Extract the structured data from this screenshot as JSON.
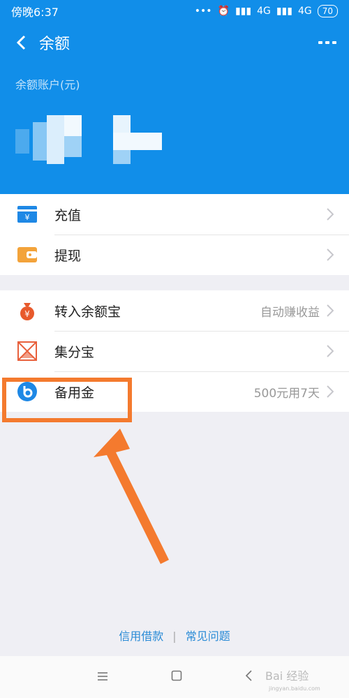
{
  "status_bar": {
    "time": "傍晚6:37",
    "network_1": "4G",
    "network_2": "4G",
    "battery": "70"
  },
  "nav": {
    "title": "余额"
  },
  "header": {
    "account_label": "余额账户(元)"
  },
  "section1": [
    {
      "label": "充值",
      "icon": "recharge-icon"
    },
    {
      "label": "提现",
      "icon": "withdraw-icon"
    }
  ],
  "section2": [
    {
      "label": "转入余额宝",
      "hint": "自动赚收益",
      "icon": "yuebao-icon"
    },
    {
      "label": "集分宝",
      "hint": "",
      "icon": "jifenbao-icon"
    },
    {
      "label": "备用金",
      "hint": "500元用7天",
      "icon": "beiyongjin-icon"
    }
  ],
  "footer": {
    "link1": "信用借款",
    "separator": "|",
    "link2": "常见问题"
  },
  "watermark": {
    "text": "Bai 经验",
    "sub": "jingyan.baidu.com"
  },
  "colors": {
    "primary": "#118ee9",
    "highlight": "#f47a2e",
    "link": "#2a8bd6"
  }
}
